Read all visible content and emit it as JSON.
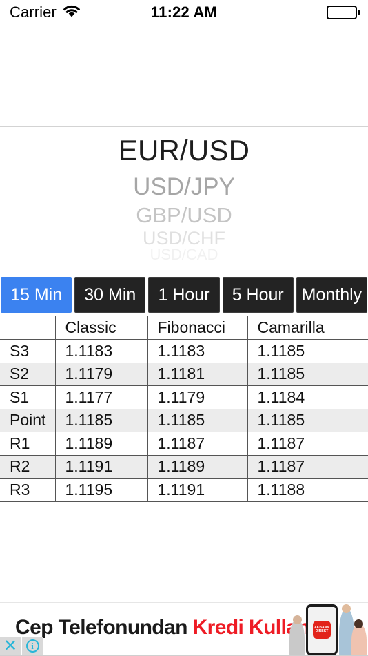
{
  "status_bar": {
    "carrier": "Carrier",
    "wifi_icon": "wifi-icon",
    "time": "11:22 AM",
    "battery_icon": "battery-full-icon"
  },
  "currency_picker": {
    "selected": "EUR/USD",
    "options": [
      "EUR/USD",
      "USD/JPY",
      "GBP/USD",
      "USD/CHF",
      "USD/CAD"
    ],
    "visible_below": [
      {
        "label": "USD/JPY"
      },
      {
        "label": "GBP/USD"
      },
      {
        "label": "USD/CHF"
      },
      {
        "label": "USD/CAD"
      }
    ]
  },
  "timeframe_segments": {
    "selected": "15 Min",
    "selected_color": "#3b82f0",
    "unselected_color": "#232323",
    "items": [
      {
        "label": "15 Min",
        "active": true
      },
      {
        "label": "30 Min",
        "active": false
      },
      {
        "label": "1 Hour",
        "active": false
      },
      {
        "label": "5 Hour",
        "active": false
      },
      {
        "label": "Monthly",
        "active": false
      }
    ]
  },
  "pivot_table": {
    "columns": [
      "",
      "Classic",
      "Fibonacci",
      "Camarilla"
    ],
    "rows": [
      {
        "level": "S3",
        "classic": "1.1183",
        "fibonacci": "1.1183",
        "camarilla": "1.1185"
      },
      {
        "level": "S2",
        "classic": "1.1179",
        "fibonacci": "1.1181",
        "camarilla": "1.1185"
      },
      {
        "level": "S1",
        "classic": "1.1177",
        "fibonacci": "1.1179",
        "camarilla": "1.1184"
      },
      {
        "level": "Point",
        "classic": "1.1185",
        "fibonacci": "1.1185",
        "camarilla": "1.1185"
      },
      {
        "level": "R1",
        "classic": "1.1189",
        "fibonacci": "1.1187",
        "camarilla": "1.1187"
      },
      {
        "level": "R2",
        "classic": "1.1191",
        "fibonacci": "1.1189",
        "camarilla": "1.1187"
      },
      {
        "level": "R3",
        "classic": "1.1195",
        "fibonacci": "1.1191",
        "camarilla": "1.1188"
      }
    ]
  },
  "ad_banner": {
    "text_black": "Cep Telefonundan",
    "text_red": "Kredi Kullan!",
    "red_color": "#ee1c25",
    "app_icon_label": "AKBANK DIREKT",
    "close_icon": "close-icon",
    "info_icon": "info-icon"
  }
}
